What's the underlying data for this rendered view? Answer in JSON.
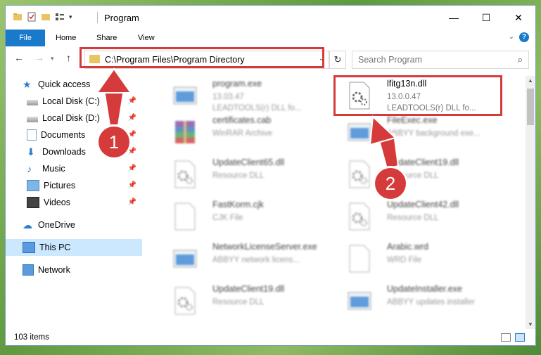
{
  "window": {
    "title": "Program",
    "minimize": "—",
    "maximize": "☐",
    "close": "✕"
  },
  "ribbon": {
    "tabs": [
      "File",
      "Home",
      "Share",
      "View"
    ],
    "help": "?"
  },
  "nav": {
    "address": "C:\\Program Files\\Program Directory",
    "search_placeholder": "Search Program"
  },
  "sidebar": {
    "items": [
      {
        "label": "Quick access",
        "icon": "star-icon"
      },
      {
        "label": "Local Disk (C:)",
        "icon": "drive-icon",
        "pinned": true
      },
      {
        "label": "Local Disk (D:)",
        "icon": "drive-icon",
        "pinned": true
      },
      {
        "label": "Documents",
        "icon": "documents-icon",
        "pinned": true
      },
      {
        "label": "Downloads",
        "icon": "download-icon",
        "pinned": true
      },
      {
        "label": "Music",
        "icon": "music-icon",
        "pinned": true
      },
      {
        "label": "Pictures",
        "icon": "pictures-icon",
        "pinned": true
      },
      {
        "label": "Videos",
        "icon": "videos-icon",
        "pinned": true
      },
      {
        "label": "OneDrive",
        "icon": "cloud-icon"
      },
      {
        "label": "This PC",
        "icon": "computer-icon",
        "selected": true
      },
      {
        "label": "Network",
        "icon": "network-icon"
      }
    ]
  },
  "files": [
    {
      "name": "program.exe",
      "line1": "13.03.47",
      "line2": "LEADTOOLS(r) DLL fo...",
      "icon": "exe-icon",
      "blurred": true
    },
    {
      "name": "lfitg13n.dll",
      "line1": "13.0.0.47",
      "line2": "LEADTOOLS(r) DLL fo...",
      "icon": "dll-gear-icon",
      "blurred": false
    },
    {
      "name": "certificates.cab",
      "line1": "WinRAR Archive",
      "line2": "",
      "icon": "archive-icon",
      "blurred": true
    },
    {
      "name": "FileExec.exe",
      "line1": "ABBYY background exe...",
      "line2": "",
      "icon": "exe-icon",
      "blurred": true
    },
    {
      "name": "UpdateClient65.dll",
      "line1": "Resource DLL",
      "line2": "",
      "icon": "dll-gear-icon",
      "blurred": true
    },
    {
      "name": "UpdateClient19.dll",
      "line1": "Resource DLL",
      "line2": "",
      "icon": "dll-gear-icon",
      "blurred": true
    },
    {
      "name": "FastKorm.cjk",
      "line1": "CJK File",
      "line2": "",
      "icon": "blank-file-icon",
      "blurred": true
    },
    {
      "name": "UpdateClient42.dll",
      "line1": "Resource DLL",
      "line2": "",
      "icon": "dll-gear-icon",
      "blurred": true
    },
    {
      "name": "NetworkLicenseServer.exe",
      "line1": "ABBYY network licens...",
      "line2": "",
      "icon": "exe-icon",
      "blurred": true
    },
    {
      "name": "Arabic.wrd",
      "line1": "WRD File",
      "line2": "",
      "icon": "blank-file-icon",
      "blurred": true
    },
    {
      "name": "UpdateClient19.dll",
      "line1": "Resource DLL",
      "line2": "",
      "icon": "dll-gear-icon",
      "blurred": true
    },
    {
      "name": "UpdateInstaller.exe",
      "line1": "ABBYY updates installer",
      "line2": "",
      "icon": "exe-icon",
      "blurred": true
    }
  ],
  "status": {
    "count": "103 items"
  },
  "callouts": [
    "1",
    "2"
  ],
  "colors": {
    "accent": "#1979ca",
    "highlight": "#d63b3b"
  }
}
